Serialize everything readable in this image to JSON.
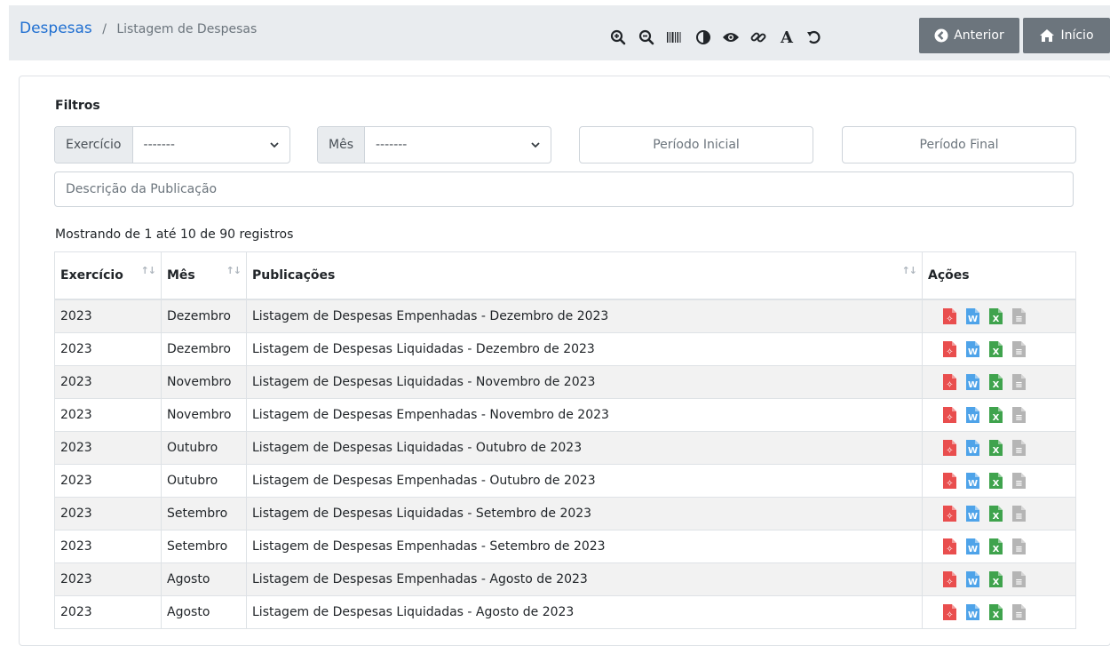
{
  "header": {
    "breadcrumb_root": "Despesas",
    "breadcrumb_separator": "/",
    "breadcrumb_current": "Listagem de Despesas",
    "tools": [
      "zoom-in-icon",
      "zoom-out-icon",
      "barcode-icon",
      "contrast-icon",
      "eye-icon",
      "link-icon",
      "font-icon",
      "reset-icon"
    ],
    "prev_label": "Anterior",
    "home_label": "Início"
  },
  "filters": {
    "title": "Filtros",
    "exercicio_label": "Exercício",
    "exercicio_value": "-------",
    "mes_label": "Mês",
    "mes_value": "-------",
    "periodo_inicial_placeholder": "Período Inicial",
    "periodo_final_placeholder": "Período Final",
    "descricao_placeholder": "Descrição da Publicação"
  },
  "table": {
    "info": "Mostrando de 1 até 10 de 90 registros",
    "headers": {
      "exercicio": "Exercício",
      "mes": "Mês",
      "publicacoes": "Publicações",
      "acoes": "Ações"
    },
    "rows": [
      {
        "exercicio": "2023",
        "mes": "Dezembro",
        "publicacao": "Listagem de Despesas Empenhadas - Dezembro de 2023"
      },
      {
        "exercicio": "2023",
        "mes": "Dezembro",
        "publicacao": "Listagem de Despesas Liquidadas - Dezembro de 2023"
      },
      {
        "exercicio": "2023",
        "mes": "Novembro",
        "publicacao": "Listagem de Despesas Liquidadas - Novembro de 2023"
      },
      {
        "exercicio": "2023",
        "mes": "Novembro",
        "publicacao": "Listagem de Despesas Empenhadas - Novembro de 2023"
      },
      {
        "exercicio": "2023",
        "mes": "Outubro",
        "publicacao": "Listagem de Despesas Liquidadas - Outubro de 2023"
      },
      {
        "exercicio": "2023",
        "mes": "Outubro",
        "publicacao": "Listagem de Despesas Empenhadas - Outubro de 2023"
      },
      {
        "exercicio": "2023",
        "mes": "Setembro",
        "publicacao": "Listagem de Despesas Liquidadas - Setembro de 2023"
      },
      {
        "exercicio": "2023",
        "mes": "Setembro",
        "publicacao": "Listagem de Despesas Empenhadas - Setembro de 2023"
      },
      {
        "exercicio": "2023",
        "mes": "Agosto",
        "publicacao": "Listagem de Despesas Empenhadas - Agosto de 2023"
      },
      {
        "exercicio": "2023",
        "mes": "Agosto",
        "publicacao": "Listagem de Despesas Liquidadas - Agosto de 2023"
      }
    ],
    "action_icons": [
      {
        "name": "pdf-icon",
        "color": "#e94e4e",
        "glyph": "✧"
      },
      {
        "name": "word-icon",
        "color": "#4ea3e9",
        "glyph": "W"
      },
      {
        "name": "excel-icon",
        "color": "#3fa34d",
        "glyph": "X"
      },
      {
        "name": "text-icon",
        "color": "#b5b5b5",
        "glyph": "≡"
      }
    ]
  }
}
